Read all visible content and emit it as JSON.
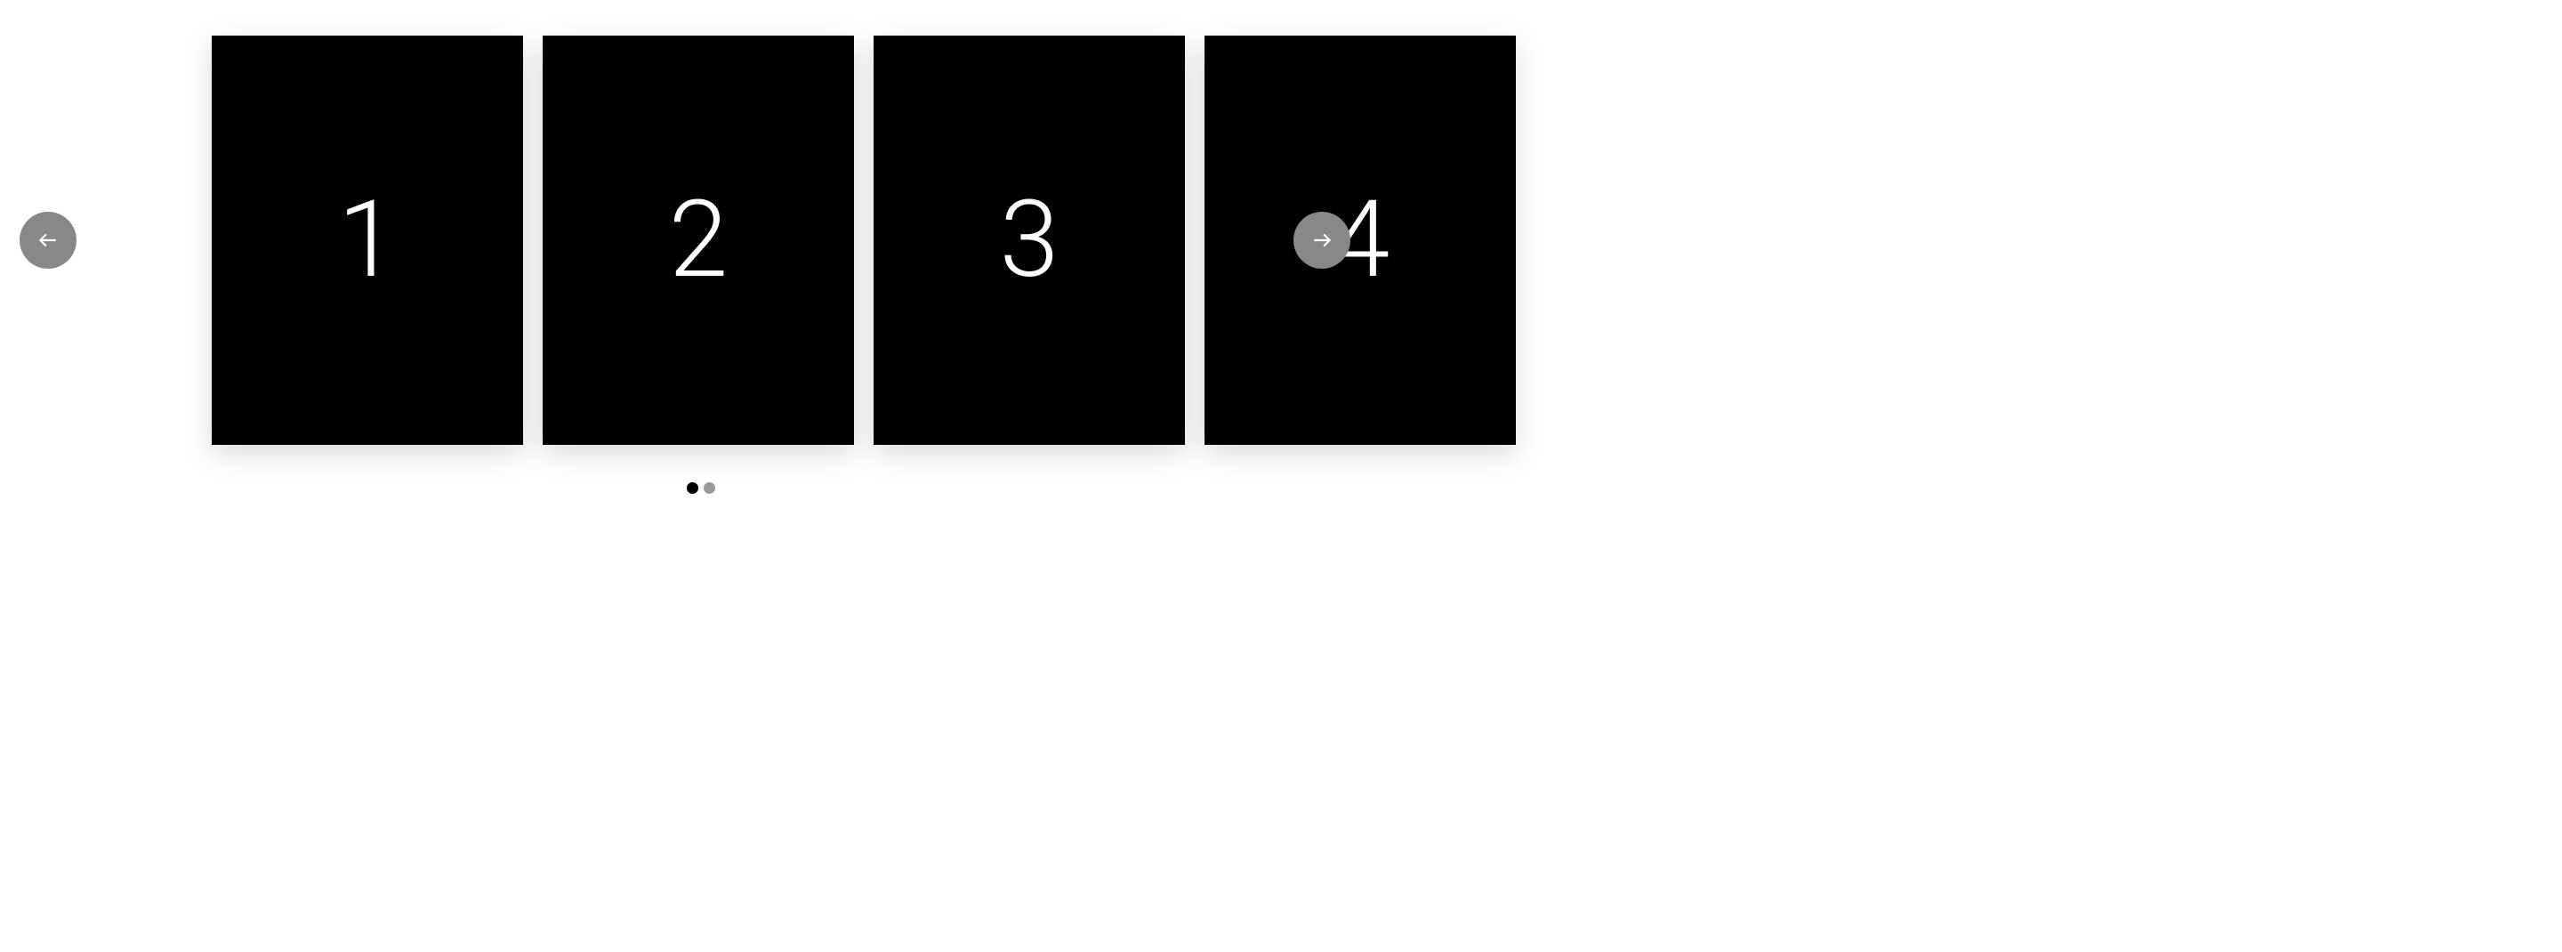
{
  "carousel": {
    "cards": [
      {
        "label": "1"
      },
      {
        "label": "2"
      },
      {
        "label": "3"
      },
      {
        "label": "4"
      }
    ],
    "pagination": {
      "total": 2,
      "current": 0
    }
  }
}
